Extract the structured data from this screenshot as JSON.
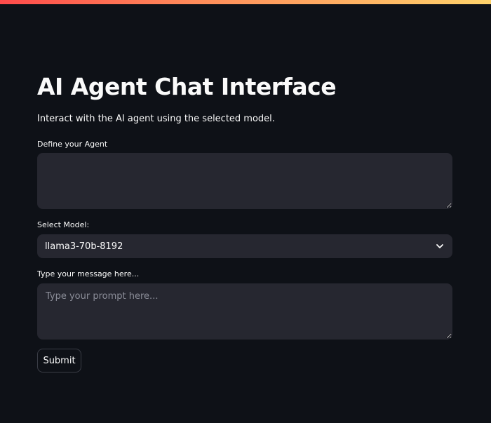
{
  "page": {
    "title": "AI Agent Chat Interface",
    "subtitle": "Interact with the AI agent using the selected model."
  },
  "form": {
    "agent_label": "Define your Agent",
    "agent_value": "",
    "model_label": "Select Model:",
    "model_selected": "llama3-70b-8192",
    "message_label": "Type your message here...",
    "message_value": "",
    "message_placeholder": "Type your prompt here...",
    "submit_label": "Submit"
  },
  "icons": {
    "select_chevron": "chevron-down-icon"
  },
  "colors": {
    "background": "#0e1117",
    "input_bg": "#262730",
    "text": "#fafafa",
    "placeholder": "#8b8d98",
    "accent_top": "#ff4b4b"
  }
}
